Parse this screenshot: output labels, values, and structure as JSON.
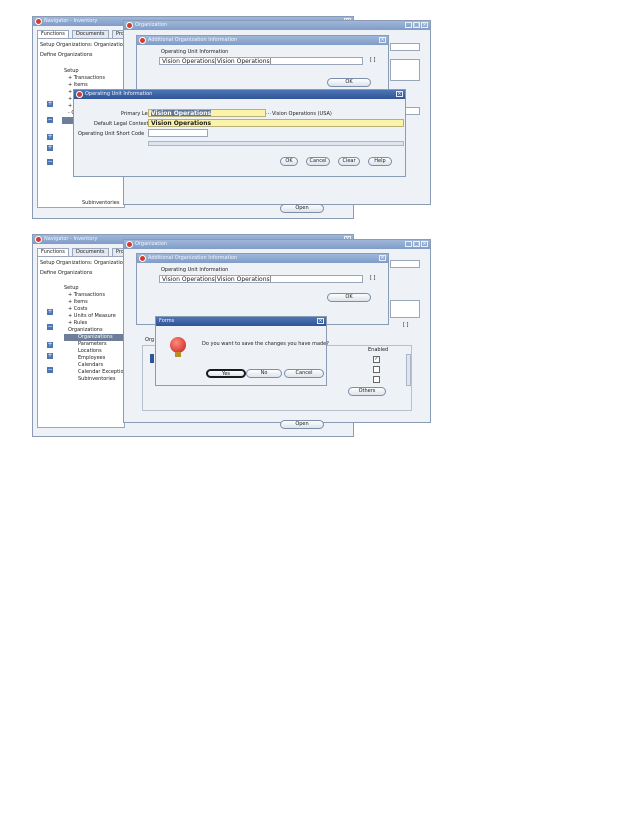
{
  "top": {
    "navigator_title": "Navigator - Inventory",
    "org_window_title": "Organization",
    "classif_title": "Additional Organization Information",
    "tabs": [
      "Functions",
      "Documents",
      "Pro"
    ],
    "setup_org_label": "Setup Organizations: Organizatio",
    "define_org_label": "Define Organizations",
    "tree": [
      "Setup",
      "+ Transactions",
      "+ Items",
      "+ C",
      "+ U",
      "+ R",
      "- O"
    ],
    "subinventories": "Subinventories",
    "ou_label": "Operating Unit Information",
    "ou_value": "Vision Operations|Vision Operations|",
    "brackets": "[ ]",
    "ok": "OK",
    "open": "Open",
    "dialog": {
      "title": "Operating Unit Information",
      "primary_ledger_label": "Primary Ledger",
      "primary_ledger_value": "Vision Operations",
      "ledger_description": "Vision Operations (USA)",
      "legal_context_label": "Default Legal Context",
      "legal_context_value": "Vision Operations",
      "short_code_label": "Operating Unit Short Code",
      "buttons": [
        "OK",
        "Cancel",
        "Clear",
        "Help"
      ]
    }
  },
  "bottom": {
    "navigator_title": "Navigator - Inventory",
    "org_window_title": "Organization",
    "classif_title": "Additional Organization Information",
    "tabs": [
      "Functions",
      "Documents",
      "Pro"
    ],
    "setup_org_label": "Setup Organizations: Organizatio",
    "define_org_label": "Define Organizations",
    "tree": [
      "Setup",
      "+ Transactions",
      "+ Items",
      "+ Costs",
      "+ Units of Measure",
      "+ Rules",
      "Organizations",
      "Organizations",
      "Parameters",
      "Locations",
      "Employees",
      "Calendars",
      "Calendar Exception",
      "Subinventories"
    ],
    "org_label": "Org",
    "ou_label": "Operating Unit Information",
    "ou_value": "Vision Operations|Vision Operations|",
    "brackets": "[ ]",
    "ok": "OK",
    "enabled": "Enabled",
    "others": "Others",
    "open": "Open",
    "forms": {
      "title": "Forms",
      "message": "Do you want to save the changes you have made?",
      "buttons": [
        "Yes",
        "No",
        "Cancel"
      ]
    }
  },
  "colors": {
    "title_dark": "#2f5597",
    "title_light": "#8fa9d2",
    "highlight": "#fbf3a8"
  }
}
